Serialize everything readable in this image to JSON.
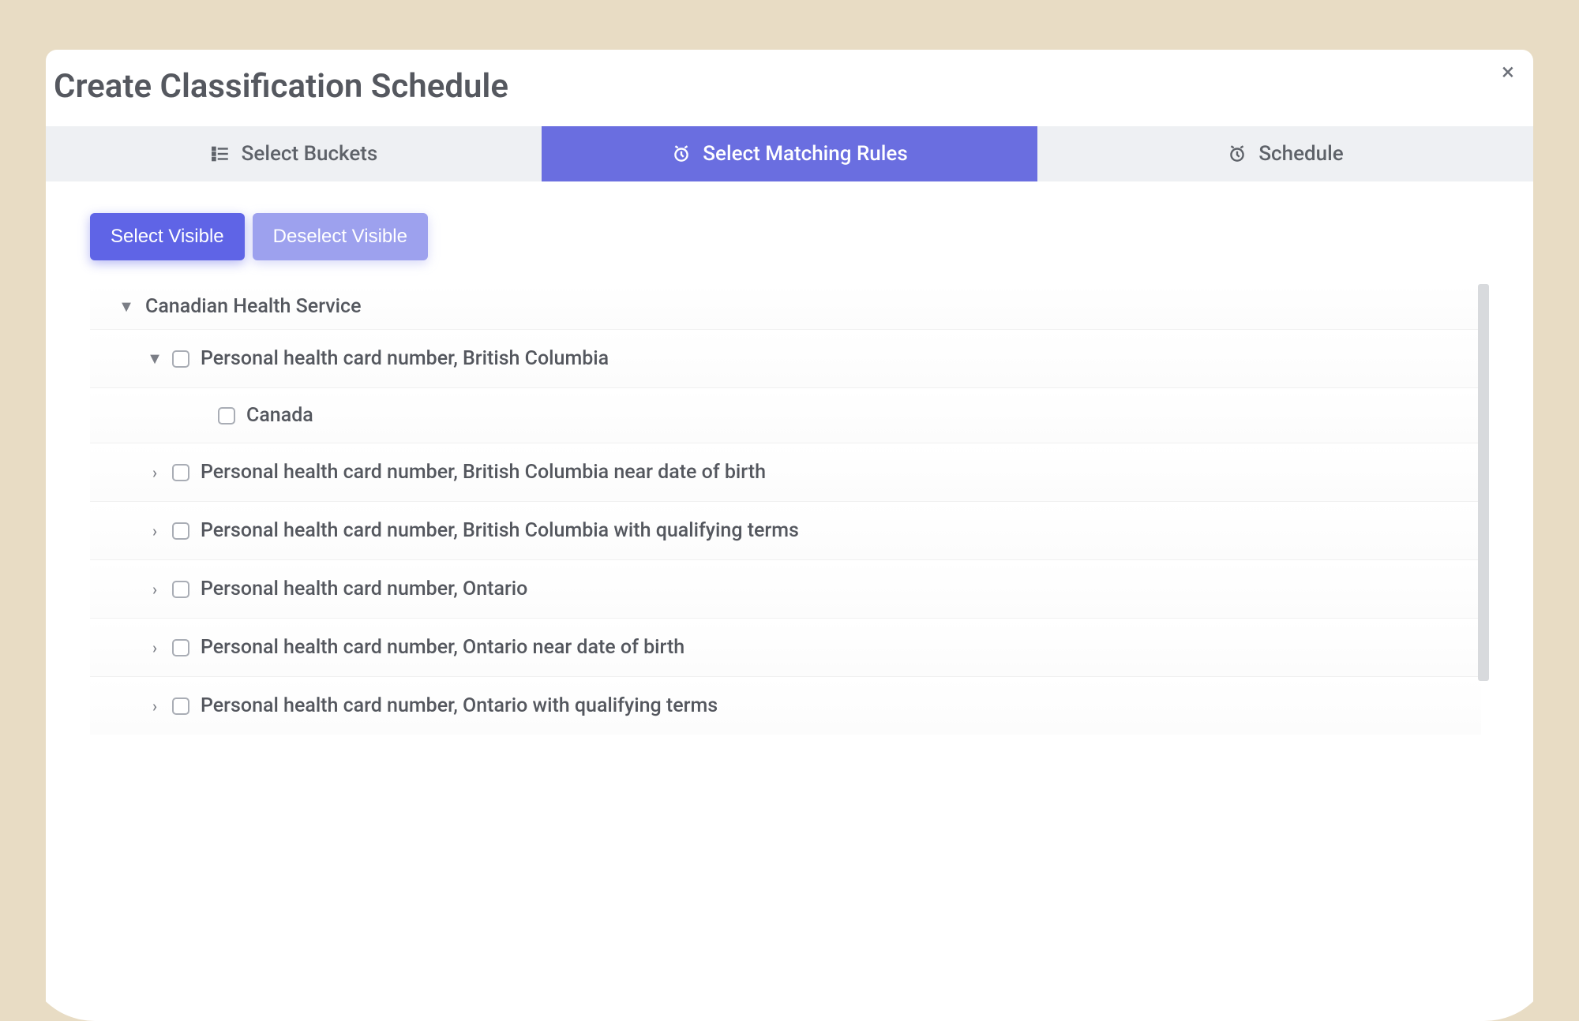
{
  "modal": {
    "title": "Create Classification Schedule",
    "close_label": "×"
  },
  "tabs": {
    "buckets": "Select Buckets",
    "rules": "Select Matching Rules",
    "schedule": "Schedule"
  },
  "buttons": {
    "select_visible": "Select Visible",
    "deselect_visible": "Deselect Visible"
  },
  "tree": {
    "group_label": "Canadian Health Service",
    "items": [
      {
        "label": "Personal health card number, British Columbia",
        "expanded": true,
        "children": [
          {
            "label": "Canada"
          }
        ]
      },
      {
        "label": "Personal health card number, British Columbia near date of birth",
        "expanded": false
      },
      {
        "label": "Personal health card number, British Columbia with qualifying terms",
        "expanded": false
      },
      {
        "label": "Personal health card number, Ontario",
        "expanded": false
      },
      {
        "label": "Personal health card number, Ontario near date of birth",
        "expanded": false
      },
      {
        "label": "Personal health card number, Ontario with qualifying terms",
        "expanded": false
      }
    ]
  }
}
